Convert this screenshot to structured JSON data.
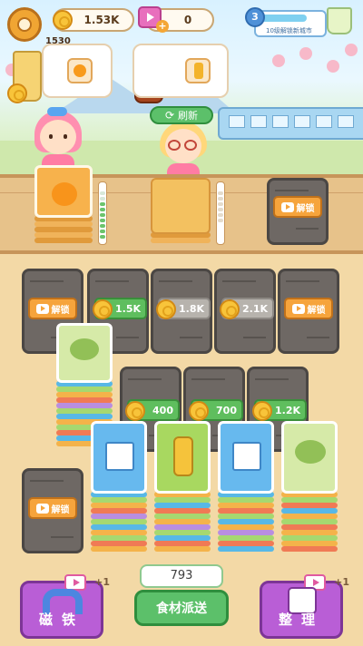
{
  "hud": {
    "coins": "1.53K",
    "tickets": "0",
    "level": "3",
    "level_text": "10级解锁新城市",
    "level_progress": 0.75
  },
  "orders": [
    {
      "reward": "1530",
      "drink_color": "#f6d373",
      "requirement": "orange"
    },
    {
      "reward": "",
      "drink_color": "#a5441d",
      "requirement": "orange-juice"
    }
  ],
  "refresh_label": "刷新",
  "counter": {
    "unlock_label": "解锁"
  },
  "board": {
    "unlock_label": "解锁",
    "row1_prices": [
      "1.5K",
      "1.8K",
      "2.1K"
    ],
    "row2_prices": [
      "400",
      "700",
      "1.2K"
    ],
    "cards": [
      "matcha",
      "milk",
      "juice-bottle",
      "milk",
      "matcha"
    ]
  },
  "bottom": {
    "magnet_label": "磁铁",
    "sort_label": "整理",
    "dispatch_label": "食材派送",
    "count": "793",
    "magnet_bonus": "+1",
    "sort_bonus": "+1"
  },
  "colors": {
    "coin": "#f8c43a",
    "green": "#5cc06a",
    "purple": "#b95ed6",
    "orange": "#f6a43c"
  }
}
